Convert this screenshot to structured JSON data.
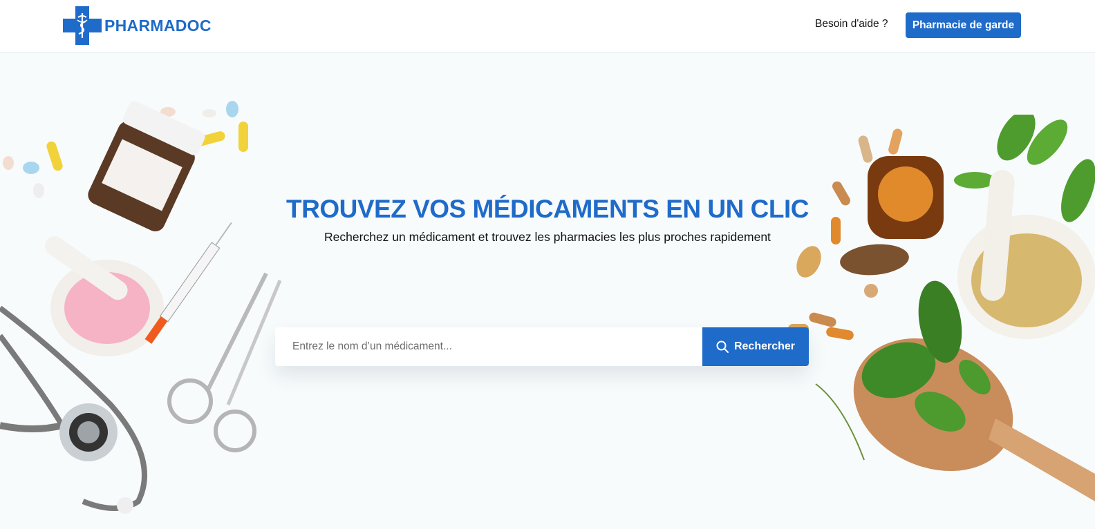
{
  "brand": {
    "name": "PHARMADOC",
    "color": "#1f6bc9"
  },
  "header": {
    "help_label": "Besoin d'aide ?",
    "guard_label": "Pharmacie de garde"
  },
  "hero": {
    "title": "TROUVEZ VOS MÉDICAMENTS EN UN CLIC",
    "subtitle": "Recherchez un médicament et trouvez les pharmacies les plus proches rapidement"
  },
  "search": {
    "placeholder": "Entrez le nom d’un médicament...",
    "value": "",
    "button_label": "Rechercher",
    "icon": "search-icon"
  },
  "decor": {
    "left": "medical-supplies-image",
    "right": "herbal-remedies-image"
  }
}
